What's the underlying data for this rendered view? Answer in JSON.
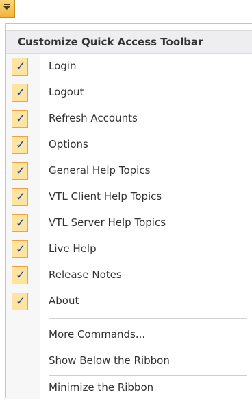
{
  "menu": {
    "header": "Customize Quick Access Toolbar",
    "checked_items": [
      {
        "label": "Login",
        "checked": true
      },
      {
        "label": "Logout",
        "checked": true
      },
      {
        "label": "Refresh Accounts",
        "checked": true
      },
      {
        "label": "Options",
        "checked": true
      },
      {
        "label": "General Help Topics",
        "checked": true
      },
      {
        "label": "VTL Client Help Topics",
        "checked": true
      },
      {
        "label": "VTL Server Help Topics",
        "checked": true
      },
      {
        "label": "Live Help",
        "checked": true
      },
      {
        "label": "Release Notes",
        "checked": true
      },
      {
        "label": "About",
        "checked": true
      }
    ],
    "check_glyph": "✓",
    "more_commands": "More Commands...",
    "show_below": "Show Below the Ribbon",
    "minimize": "Minimize the Ribbon"
  },
  "icons": {
    "qat_dropdown": "dropdown-arrow-icon",
    "checkmark": "checkmark-icon"
  },
  "colors": {
    "accent_fill": "#fde4a1",
    "accent_border": "#f2a13c",
    "check_color": "#1b3f99"
  }
}
